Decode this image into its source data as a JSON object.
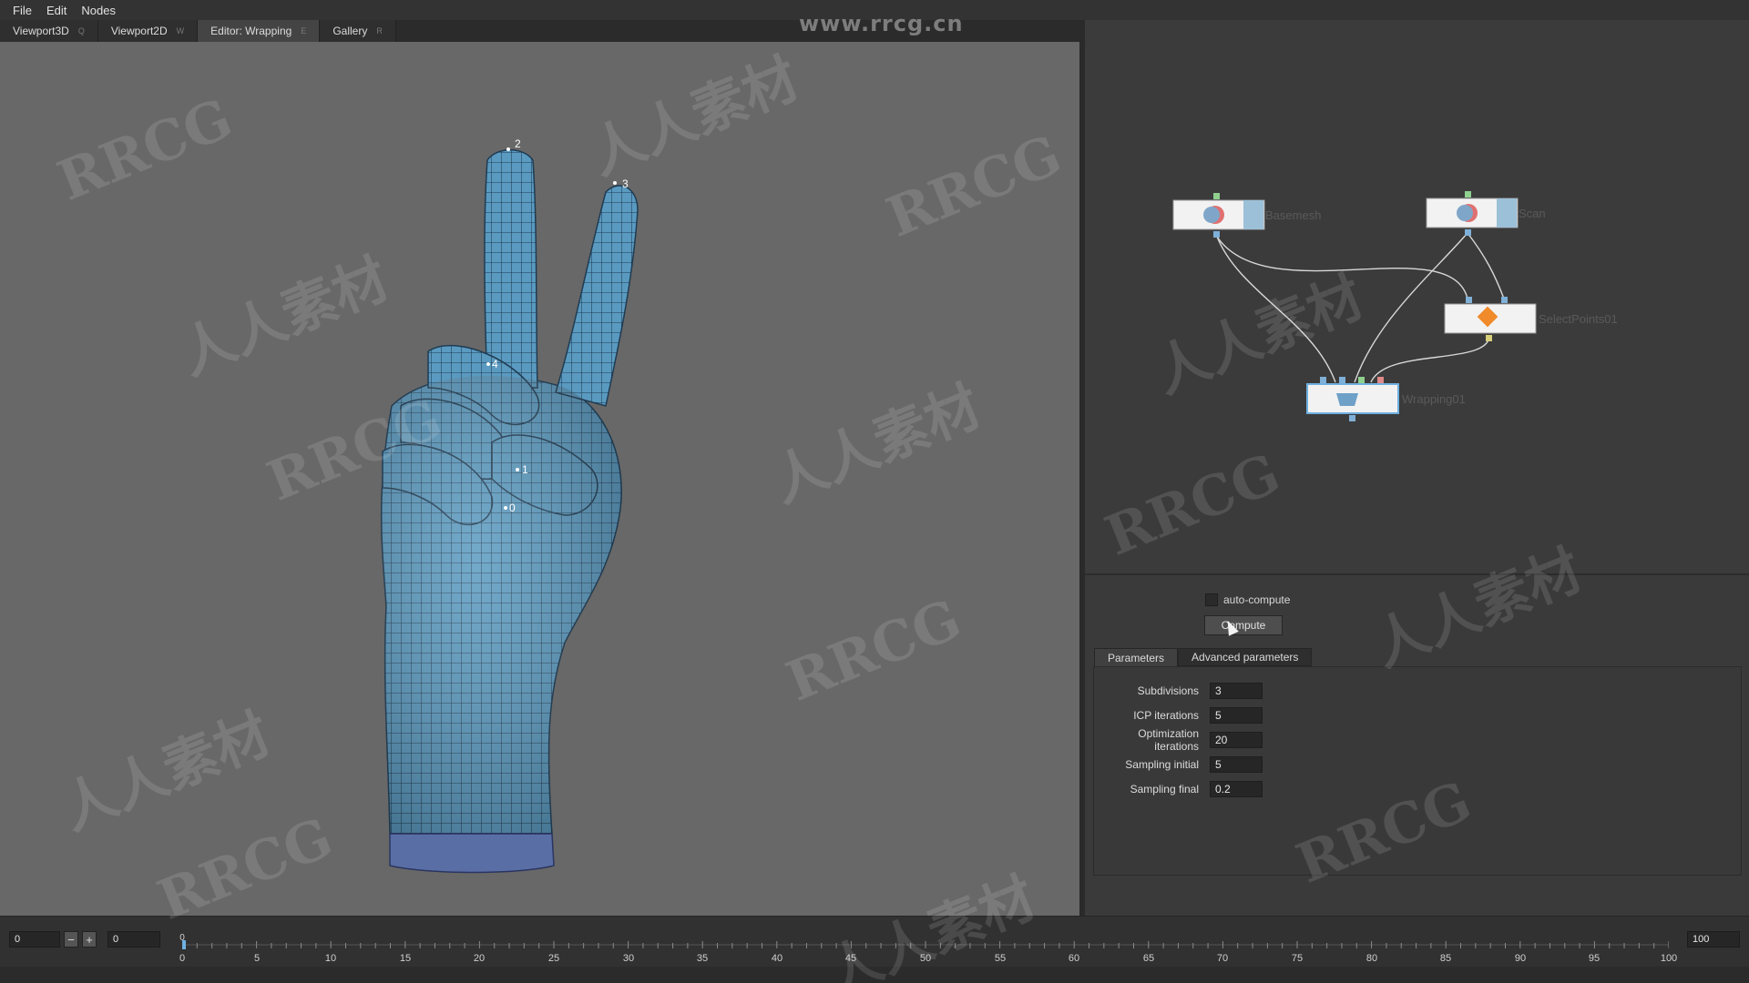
{
  "menu": [
    "File",
    "Edit",
    "Nodes"
  ],
  "tabs": [
    {
      "label": "Viewport3D",
      "key": "Q"
    },
    {
      "label": "Viewport2D",
      "key": "W"
    },
    {
      "label": "Editor: Wrapping",
      "key": "E"
    },
    {
      "label": "Gallery",
      "key": "R"
    }
  ],
  "active_tab": "Editor: Wrapping",
  "site_watermark": "www.rrcg.cn",
  "viewport": {
    "point_labels": [
      "2",
      "3",
      "4",
      "1",
      "0"
    ]
  },
  "nodes": {
    "basemesh": "Basemesh",
    "scan": "Scan",
    "select_points": "SelectPoints01",
    "wrapping": "Wrapping01"
  },
  "props": {
    "auto_compute_label": "auto-compute",
    "auto_compute_checked": false,
    "compute_label": "Compute",
    "tab_parameters": "Parameters",
    "tab_advanced": "Advanced parameters",
    "params": [
      {
        "label": "Subdivisions",
        "value": "3"
      },
      {
        "label": "ICP iterations",
        "value": "5"
      },
      {
        "label": "Optimization iterations",
        "value": "20"
      },
      {
        "label": "Sampling initial",
        "value": "5"
      },
      {
        "label": "Sampling final",
        "value": "0.2"
      }
    ]
  },
  "timeline": {
    "start_value": "0",
    "current_value": "0",
    "end_value": "100",
    "current_frame_label": "0",
    "tick_labels": [
      "0",
      "5",
      "10",
      "15",
      "20",
      "25",
      "30",
      "35",
      "40",
      "45",
      "50",
      "55",
      "60",
      "65",
      "70",
      "75",
      "80",
      "85",
      "90",
      "95",
      "100"
    ],
    "minus_label": "−",
    "plus_label": "+"
  },
  "watermarks": {
    "latin": "RRCG",
    "cjk": "人人素材"
  },
  "colors": {
    "mesh": "#5a9ac0",
    "mesh_line": "#1f3b52",
    "wrist": "#5a6ea6",
    "node_port_blue": "#7fb0d8",
    "node_port_green": "#8fd08f",
    "node_port_red": "#e08a8a",
    "node_port_yellow": "#d8cf7a",
    "select_icon": "#f08a2a"
  }
}
